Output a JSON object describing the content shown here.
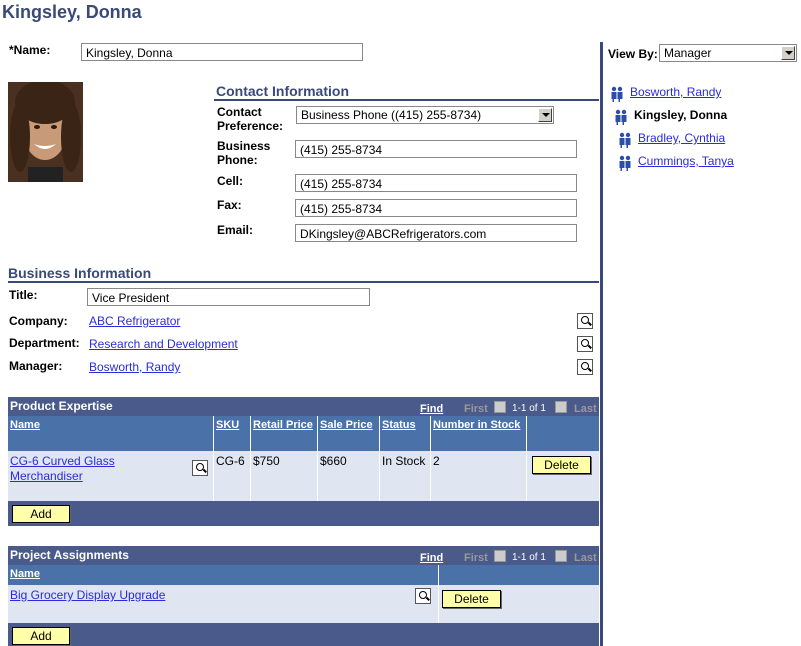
{
  "header": {
    "title": "Kingsley, Donna"
  },
  "name_field": {
    "label": "*Name:",
    "value": "Kingsley, Donna"
  },
  "contact": {
    "heading": "Contact Information",
    "preference_label": "Contact Preference:",
    "preference_value": "Business Phone ((415) 255-8734)",
    "business_phone_label": "Business Phone:",
    "business_phone_value": "(415) 255-8734",
    "cell_label": "Cell:",
    "cell_value": "(415) 255-8734",
    "fax_label": "Fax:",
    "fax_value": "(415) 255-8734",
    "email_label": "Email:",
    "email_value": "DKingsley@ABCRefrigerators.com"
  },
  "business": {
    "heading": "Business Information",
    "title_label": "Title:",
    "title_value": "Vice President",
    "company_label": "Company:",
    "company_value": "ABC Refrigerator",
    "department_label": "Department:",
    "department_value": "Research and Development",
    "manager_label": "Manager:",
    "manager_value": "Bosworth, Randy"
  },
  "product_grid": {
    "title": "Product Expertise",
    "find": "Find",
    "first": "First",
    "range": "1-1 of 1",
    "last": "Last",
    "columns": [
      "Name",
      "SKU",
      "Retail Price",
      "Sale Price",
      "Status",
      "Number in Stock"
    ],
    "rows": [
      {
        "name": "CG-6 Curved Glass Merchandiser",
        "sku": "CG-6",
        "retail": "$750",
        "sale": "$660",
        "status": "In Stock",
        "stock": "2",
        "delete": "Delete"
      }
    ],
    "add": "Add"
  },
  "project_grid": {
    "title": "Project Assignments",
    "find": "Find",
    "first": "First",
    "range": "1-1 of 1",
    "last": "Last",
    "columns": [
      "Name"
    ],
    "rows": [
      {
        "name": "Big Grocery Display Upgrade",
        "delete": "Delete"
      }
    ],
    "add": "Add"
  },
  "side": {
    "view_by_label": "View By:",
    "view_by_value": "Manager",
    "tree": [
      {
        "name": "Bosworth, Randy",
        "current": false
      },
      {
        "name": "Kingsley, Donna",
        "current": true
      },
      {
        "name": "Bradley, Cynthia",
        "current": false
      },
      {
        "name": "Cummings, Tanya",
        "current": false
      }
    ]
  },
  "icons": {
    "lookup": "magnifier-icon",
    "person": "person-icon"
  },
  "colors": {
    "accent": "#3a4a78",
    "grid_header": "#4a5a8a",
    "column_header": "#4a71a8",
    "row_bg": "#dfe6f2",
    "button_bg": "#ffffa8",
    "link": "#2b2bd9"
  }
}
